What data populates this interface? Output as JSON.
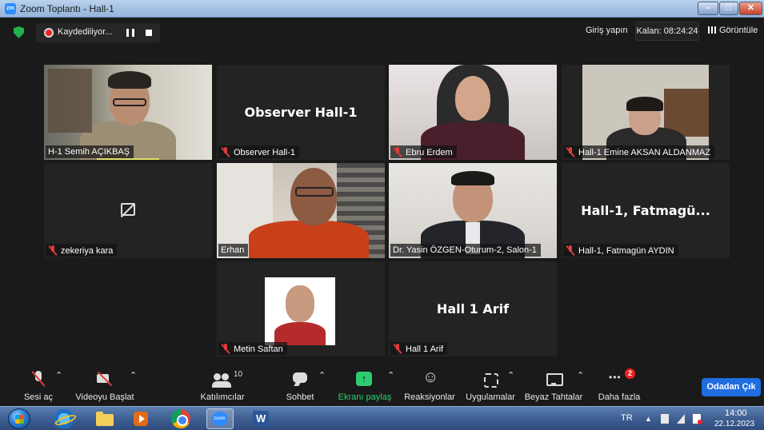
{
  "window": {
    "title": "Zoom Toplantı - Hall-1",
    "app_icon": "zm"
  },
  "topbar": {
    "recording_label": "Kaydediliyor...",
    "signin_label": "Giriş yapın",
    "timer_label": "Kalan: 08:24:24",
    "view_label": "Görüntüle"
  },
  "tiles": [
    {
      "name": "H-1 Semih AÇIKBAŞ",
      "muted": false,
      "video": true
    },
    {
      "name": "Observer Hall-1",
      "muted": true,
      "video": false,
      "display_name": "Observer Hall-1"
    },
    {
      "name": "Ebru Erdem",
      "muted": true,
      "video": true
    },
    {
      "name": "Hall-1 Emine AKSAN ALDANMAZ",
      "muted": true,
      "video": true
    },
    {
      "name": "zekeriya kara",
      "muted": true,
      "video": false
    },
    {
      "name": "Erhan",
      "muted": false,
      "video": true
    },
    {
      "name": "Dr. Yasin ÖZGEN-Oturum-2, Salon-1",
      "muted": false,
      "video": true,
      "active_speaker": true
    },
    {
      "name": "Hall-1, Fatmagün AYDIN",
      "muted": true,
      "video": false,
      "display_name": "Hall-1,  Fatmagü..."
    },
    {
      "name": "Metin Saftan",
      "muted": true,
      "video": false
    },
    {
      "name": "Hall 1 Arif",
      "muted": true,
      "video": false,
      "display_name": "Hall 1 Arif"
    }
  ],
  "toolbar": {
    "mute_label": "Sesi aç",
    "video_label": "Videoyu Başlat",
    "participants_label": "Katılımcılar",
    "participants_count": "10",
    "chat_label": "Sohbet",
    "share_label": "Ekranı paylaş",
    "reactions_label": "Reaksiyonlar",
    "apps_label": "Uygulamalar",
    "whiteboard_label": "Beyaz Tahtalar",
    "more_label": "Daha fazla",
    "more_badge": "2",
    "leave_label": "Odadan Çık"
  },
  "taskbar": {
    "zoom_label": "zoom",
    "language": "TR",
    "time": "14:00",
    "date": "22.12.2023"
  },
  "colors": {
    "active_speaker_border": "#cfe36b",
    "share_green": "#2ecc71",
    "leave_blue": "#1f6de0",
    "muted_red": "#e03b3b"
  }
}
